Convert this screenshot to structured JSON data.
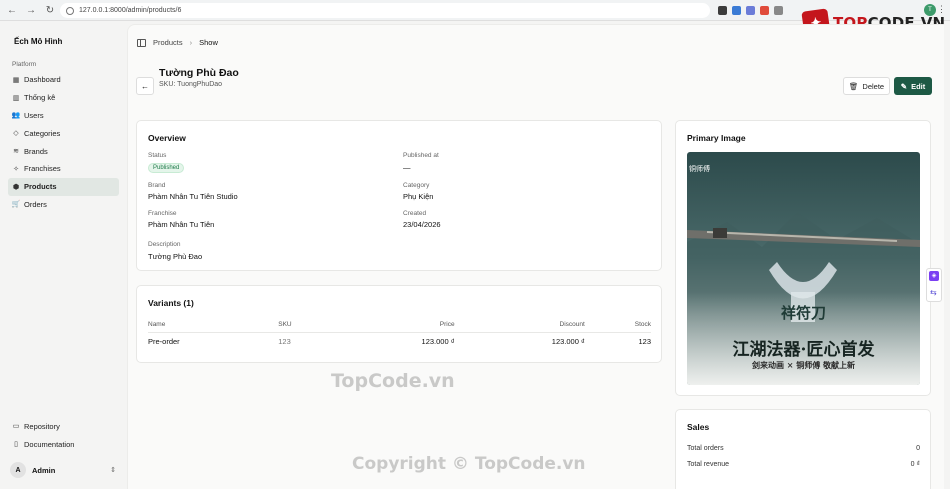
{
  "browser": {
    "url": "127.0.0.1:8000/admin/products/6",
    "profile_initial": "T"
  },
  "watermark": {
    "logo_text_a": "TOP",
    "logo_text_b": "CODE.VN",
    "center": "TopCode.vn",
    "bottom": "Copyright © TopCode.vn"
  },
  "sidebar": {
    "brand": "Ếch Mô Hình",
    "section_label": "Platform",
    "items": [
      {
        "label": "Dashboard",
        "icon": "grid-icon"
      },
      {
        "label": "Thống kê",
        "icon": "bar-chart-icon"
      },
      {
        "label": "Users",
        "icon": "users-icon"
      },
      {
        "label": "Categories",
        "icon": "shapes-icon"
      },
      {
        "label": "Brands",
        "icon": "layers-icon"
      },
      {
        "label": "Franchises",
        "icon": "sparkles-icon"
      },
      {
        "label": "Products",
        "icon": "package-icon",
        "active": true
      },
      {
        "label": "Orders",
        "icon": "cart-icon"
      }
    ],
    "footer_items": [
      {
        "label": "Repository",
        "icon": "folder-icon"
      },
      {
        "label": "Documentation",
        "icon": "book-icon"
      }
    ],
    "user": {
      "initial": "A",
      "name": "Admin"
    }
  },
  "breadcrumb": {
    "parent": "Products",
    "current": "Show"
  },
  "header": {
    "title": "Tường Phù Đao",
    "sku_line": "SKU: TuongPhuDao",
    "delete_label": "Delete",
    "edit_label": "Edit"
  },
  "overview": {
    "title": "Overview",
    "status_label": "Status",
    "status_value": "Published",
    "published_label": "Published at",
    "published_value": "—",
    "brand_label": "Brand",
    "brand_value": "Phàm Nhân Tu Tiên Studio",
    "category_label": "Category",
    "category_value": "Phụ Kiện",
    "franchise_label": "Franchise",
    "franchise_value": "Phàm Nhân Tu Tiên",
    "created_label": "Created",
    "created_value": "23/04/2026",
    "description_label": "Description",
    "description_value": "Tường Phù Đao"
  },
  "variants": {
    "title": "Variants (1)",
    "columns": [
      "Name",
      "SKU",
      "Price",
      "Discount",
      "Stock"
    ],
    "rows": [
      {
        "name": "Pre-order",
        "sku": "123",
        "price": "123.000 ₫",
        "discount": "123.000 ₫",
        "stock": "123"
      }
    ]
  },
  "primary_image": {
    "title": "Primary Image",
    "logo_text": "铜师傅",
    "cn_title": "祥符刀",
    "cn_headline": "江湖法器·匠心首发",
    "cn_sub": "剑来动画 × 铜师傅 敬献上新"
  },
  "sales": {
    "title": "Sales",
    "total_orders_label": "Total orders",
    "total_orders_value": "0",
    "total_revenue_label": "Total revenue",
    "total_revenue_value": "0 ₫"
  },
  "colors": {
    "accent": "#1d5945",
    "active_nav": "#e1e7e3",
    "badge_green": "#1f7a4a"
  }
}
